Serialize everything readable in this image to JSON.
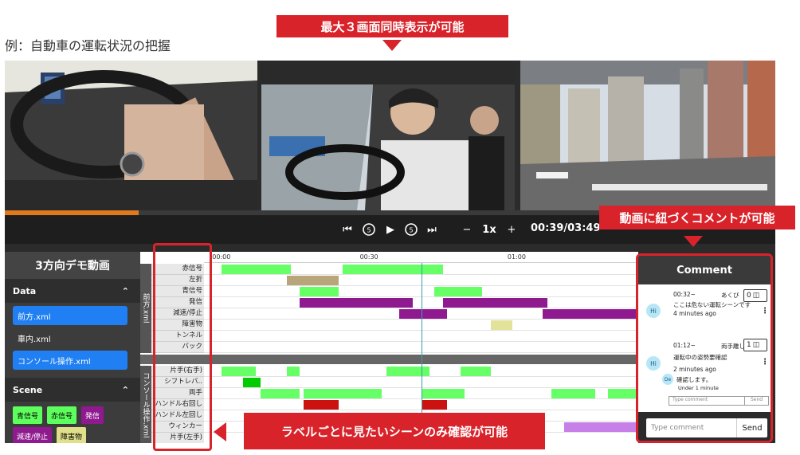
{
  "caption": "例：自動車の運転状況の把握",
  "callouts": {
    "top": "最大３画面同時表示が可能",
    "comment": "動画に紐づくコメントが可能",
    "label": "ラベルごとに見たいシーンのみ確認が可能"
  },
  "player": {
    "progress_fraction": 0.174,
    "speed": "1x",
    "time": "00:39/03:49"
  },
  "sidebar": {
    "title": "3方向デモ動画",
    "data_section": "Data",
    "files": [
      {
        "label": "前方.xml",
        "selected": true
      },
      {
        "label": "車内.xml",
        "selected": false
      },
      {
        "label": "コンソール操作.xml",
        "selected": true
      }
    ],
    "scene_section": "Scene",
    "tags": [
      {
        "label": "青信号",
        "color": "#5dff5d",
        "text": "#000000"
      },
      {
        "label": "赤信号",
        "color": "#5dff5d",
        "text": "#000000"
      },
      {
        "label": "発信",
        "color": "#8f1a8f",
        "text": "#ffffff"
      },
      {
        "label": "減速/停止",
        "color": "#8f1a8f",
        "text": "#ffffff"
      },
      {
        "label": "障害物",
        "color": "#e0e08a",
        "text": "#000000"
      }
    ]
  },
  "timeline": {
    "ticks": [
      "00:00",
      "00:30",
      "01:00"
    ],
    "groups": [
      {
        "name": "前方.xml",
        "rows": [
          {
            "label": "赤信号",
            "segments": [
              {
                "start": 0.04,
                "end": 0.2,
                "color": "#66ff66"
              },
              {
                "start": 0.32,
                "end": 0.55,
                "color": "#66ff66"
              }
            ]
          },
          {
            "label": "左折",
            "segments": [
              {
                "start": 0.19,
                "end": 0.31,
                "color": "#b8a67a"
              }
            ]
          },
          {
            "label": "青信号",
            "segments": [
              {
                "start": 0.22,
                "end": 0.31,
                "color": "#66ff66"
              },
              {
                "start": 0.53,
                "end": 0.64,
                "color": "#66ff66"
              }
            ]
          },
          {
            "label": "発信",
            "segments": [
              {
                "start": 0.22,
                "end": 0.48,
                "color": "#8f1a8f"
              },
              {
                "start": 0.55,
                "end": 0.79,
                "color": "#8f1a8f"
              }
            ]
          },
          {
            "label": "減速/停止",
            "segments": [
              {
                "start": 0.45,
                "end": 0.56,
                "color": "#8f1a8f"
              },
              {
                "start": 0.78,
                "end": 1.0,
                "color": "#8f1a8f"
              }
            ]
          },
          {
            "label": "障害物",
            "segments": [
              {
                "start": 0.66,
                "end": 0.71,
                "color": "#e2e29a"
              }
            ]
          },
          {
            "label": "トンネル",
            "segments": []
          },
          {
            "label": "バック",
            "segments": []
          }
        ]
      },
      {
        "name": "コンソール操作.xml",
        "rows": [
          {
            "label": "片手(右手)",
            "segments": [
              {
                "start": 0.04,
                "end": 0.12,
                "color": "#66ff66"
              },
              {
                "start": 0.19,
                "end": 0.22,
                "color": "#66ff66"
              },
              {
                "start": 0.42,
                "end": 0.52,
                "color": "#66ff66"
              },
              {
                "start": 0.59,
                "end": 0.66,
                "color": "#66ff66"
              }
            ]
          },
          {
            "label": "シフトレバ..",
            "segments": [
              {
                "start": 0.09,
                "end": 0.13,
                "color": "#00cc00"
              }
            ]
          },
          {
            "label": "両手",
            "segments": [
              {
                "start": 0.13,
                "end": 0.22,
                "color": "#66ff66"
              },
              {
                "start": 0.23,
                "end": 0.41,
                "color": "#66ff66"
              },
              {
                "start": 0.5,
                "end": 0.6,
                "color": "#66ff66"
              },
              {
                "start": 0.8,
                "end": 0.9,
                "color": "#66ff66"
              },
              {
                "start": 0.93,
                "end": 1.0,
                "color": "#66ff66"
              }
            ]
          },
          {
            "label": "ハンドル右回し",
            "segments": [
              {
                "start": 0.23,
                "end": 0.31,
                "color": "#cc1111"
              },
              {
                "start": 0.5,
                "end": 0.56,
                "color": "#cc1111"
              }
            ]
          },
          {
            "label": "ハンドル左回し",
            "segments": []
          },
          {
            "label": "ウィンカー",
            "segments": [
              {
                "start": 0.83,
                "end": 1.0,
                "color": "#c680e8"
              }
            ]
          },
          {
            "label": "片手(左手)",
            "segments": []
          }
        ]
      }
    ],
    "playhead_fraction": 0.5
  },
  "comments": {
    "title": "Comment",
    "items": [
      {
        "time": "00:32~",
        "user": "あくび",
        "count": "0",
        "text": "ここは危ない運転シーンです",
        "ago": "4 minutes ago",
        "avatar": "Hi"
      },
      {
        "time": "01:12~",
        "user": "両手離し",
        "count": "1",
        "text": "運転中の姿勢要確認",
        "ago": "2 minutes ago",
        "avatar": "Hi",
        "reply": {
          "avatar": "De",
          "text": "確認します。",
          "ago": "Under 1 minute"
        }
      }
    ],
    "mini_placeholder": "Type comment",
    "mini_send": "Send",
    "placeholder": "Type comment",
    "send": "Send"
  }
}
